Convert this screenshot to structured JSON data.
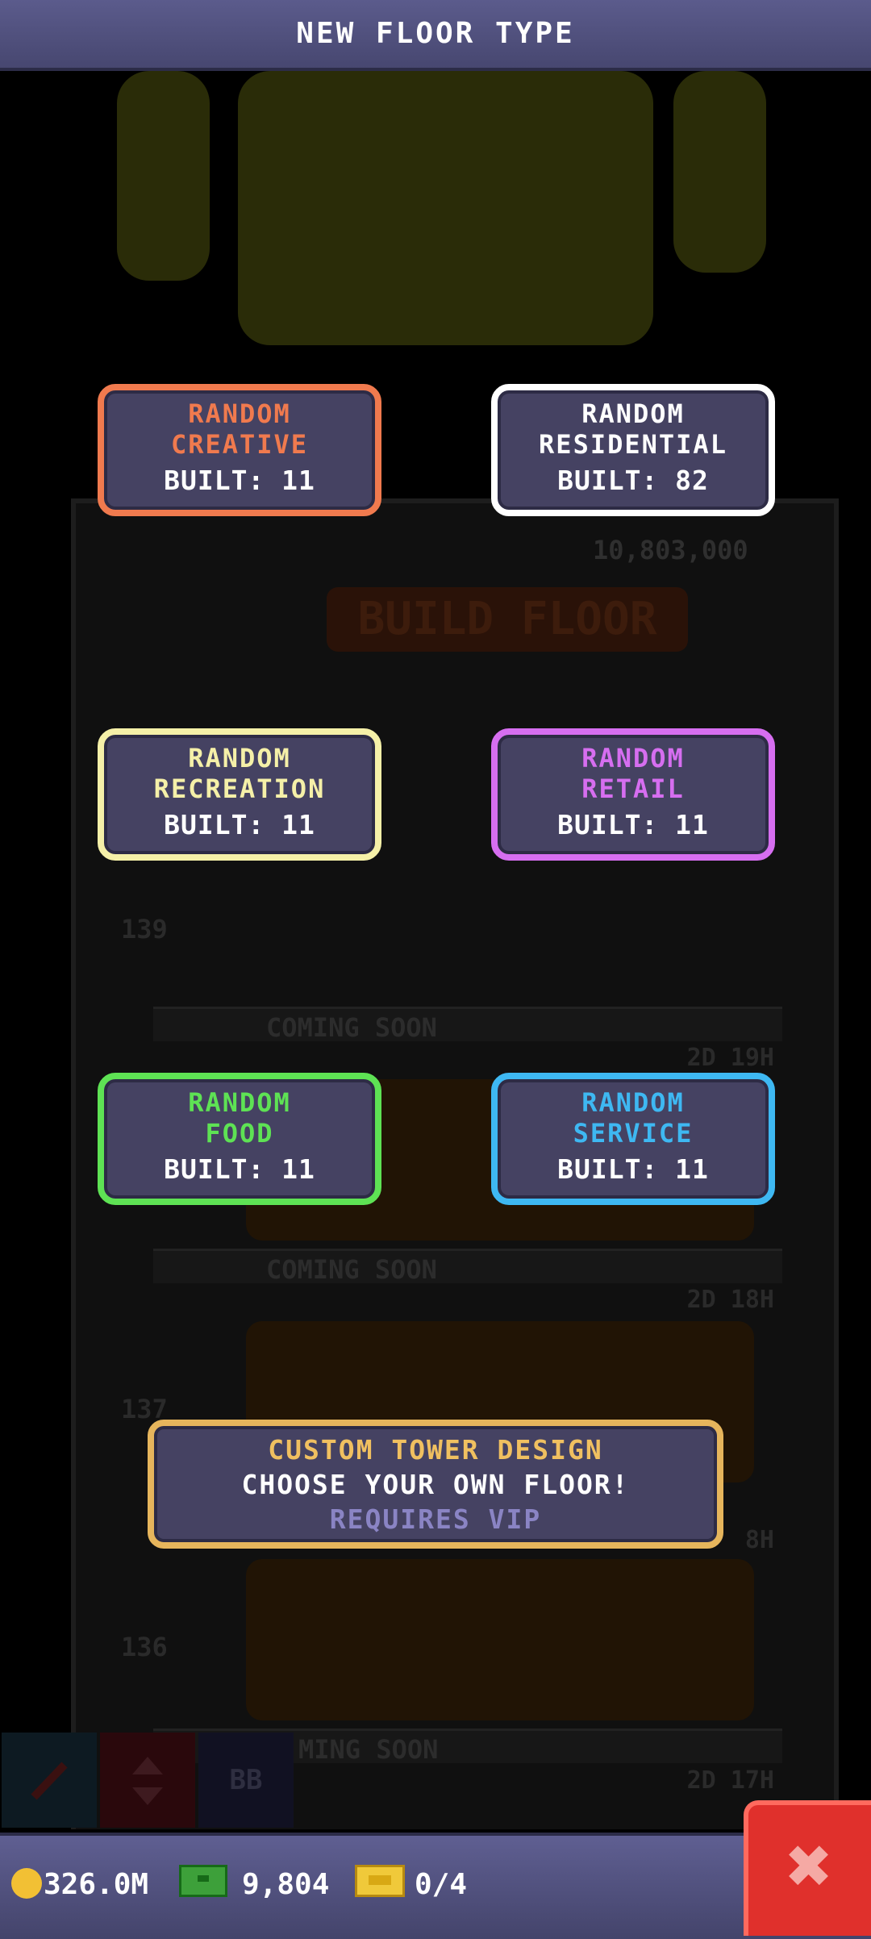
{
  "header": {
    "title": "NEW FLOOR TYPE"
  },
  "cards": [
    {
      "name_lines": [
        "RANDOM",
        "CREATIVE"
      ],
      "built": "BUILT: 11",
      "color": "#f07a4e"
    },
    {
      "name_lines": [
        "RANDOM",
        "RESIDENTIAL"
      ],
      "built": "BUILT: 82",
      "color": "#ffffff"
    },
    {
      "name_lines": [
        "RANDOM",
        "RECREATION"
      ],
      "built": "BUILT: 11",
      "color": "#f5f0a8"
    },
    {
      "name_lines": [
        "RANDOM",
        "RETAIL"
      ],
      "built": "BUILT: 11",
      "color": "#d66ef0"
    },
    {
      "name_lines": [
        "RANDOM",
        "FOOD"
      ],
      "built": "BUILT: 11",
      "color": "#5ee254"
    },
    {
      "name_lines": [
        "RANDOM",
        "SERVICE"
      ],
      "built": "BUILT: 11",
      "color": "#3eb8f2"
    }
  ],
  "custom": {
    "title": "CUSTOM TOWER DESIGN",
    "subtitle": "CHOOSE YOUR OWN FLOOR!",
    "requirement": "REQUIRES VIP",
    "color": "#e6b55c"
  },
  "background": {
    "build_cost": "10,803,000",
    "build_label": "BUILD FLOOR",
    "floor_numbers": [
      "139",
      "137",
      "136"
    ],
    "coming_soon": [
      "COMING SOON",
      "COMING SOON",
      "MING SOON"
    ],
    "timers": [
      "2D 19H",
      "2D 18H",
      "8H",
      "2D 17H"
    ],
    "toolbar_label": "BB"
  },
  "stats": {
    "coins": "326.0M",
    "bux": "9,804",
    "tickets": "0/4"
  },
  "close": {
    "label": "✖",
    "icon": "close-icon"
  }
}
